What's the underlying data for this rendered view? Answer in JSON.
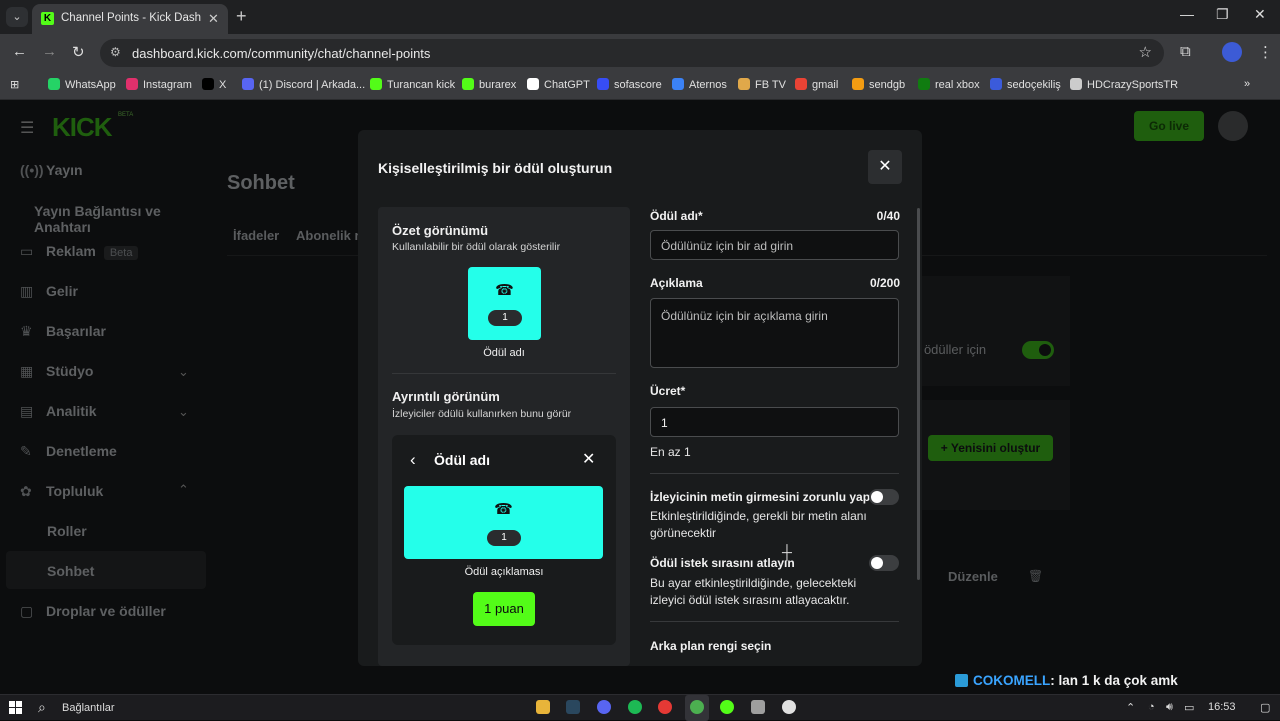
{
  "browser": {
    "tab_title": "Channel Points - Kick Dashboar",
    "url": "dashboard.kick.com/community/chat/channel-points",
    "bookmarks": [
      {
        "label": "WhatsApp",
        "color": "#25d366"
      },
      {
        "label": "Instagram",
        "color": "#e1306c"
      },
      {
        "label": "X",
        "color": "#000000"
      },
      {
        "label": "(1) Discord | Arkada...",
        "color": "#5865f2"
      },
      {
        "label": "Turancan kick",
        "color": "#53fc18"
      },
      {
        "label": "burarex",
        "color": "#53fc18"
      },
      {
        "label": "ChatGPT",
        "color": "#ffffff"
      },
      {
        "label": "sofascore",
        "color": "#374df5"
      },
      {
        "label": "Aternos",
        "color": "#3b82f6"
      },
      {
        "label": "FB TV",
        "color": "#e0a84a"
      },
      {
        "label": "gmail",
        "color": "#ea4335"
      },
      {
        "label": "sendgb",
        "color": "#f39c12"
      },
      {
        "label": "real xbox",
        "color": "#107c10"
      },
      {
        "label": "sedoçekiliş",
        "color": "#3b5bdb"
      },
      {
        "label": "HDCrazySportsTR",
        "color": "#cccccc"
      }
    ]
  },
  "sidebar": {
    "logo": "KICK",
    "logo_beta": "BETA",
    "items": [
      {
        "label": "Yayın",
        "icon": "broadcast-icon"
      },
      {
        "label": "Yayın Bağlantısı ve Anahtarı",
        "icon": ""
      },
      {
        "label": "Reklam",
        "icon": "ad-icon",
        "badge": "Beta"
      },
      {
        "label": "Gelir",
        "icon": "revenue-icon"
      },
      {
        "label": "Başarılar",
        "icon": "trophy-icon"
      },
      {
        "label": "Stüdyo",
        "icon": "studio-icon"
      },
      {
        "label": "Analitik",
        "icon": "analytics-icon"
      },
      {
        "label": "Denetleme",
        "icon": "moderation-icon"
      },
      {
        "label": "Topluluk",
        "icon": "community-icon"
      },
      {
        "label": "Roller",
        "icon": ""
      },
      {
        "label": "Sohbet",
        "icon": ""
      },
      {
        "label": "Droplar ve ödüller",
        "icon": "drops-icon"
      }
    ]
  },
  "main": {
    "title": "Sohbet",
    "tabs": [
      "İfadeler",
      "Abonelik r"
    ],
    "bg_text_rewards": "r ödüller için",
    "bg_create_button": "Yenisini oluştur",
    "bg_edit": "Düzenle",
    "go_live": "Go live"
  },
  "modal": {
    "title": "Kişiselleştirilmiş bir ödül oluşturun",
    "preview": {
      "summary_title": "Özet görünümü",
      "summary_sub": "Kullanılabilir bir ödül olarak gösterilir",
      "reward_cost": "1",
      "reward_name": "Ödül adı",
      "detail_title": "Ayrıntılı görünüm",
      "detail_sub": "İzleyiciler ödülü kullanırken bunu görür",
      "detail_header": "Ödül adı",
      "detail_cost": "1",
      "detail_desc": "Ödül açıklaması",
      "detail_button": "1 puan",
      "card_color": "#24ffea"
    },
    "form": {
      "name_label": "Ödül adı*",
      "name_count": "0/40",
      "name_placeholder": "Ödülünüz için bir ad girin",
      "desc_label": "Açıklama",
      "desc_count": "0/200",
      "desc_placeholder": "Ödülünüz için bir açıklama girin",
      "price_label": "Ücret*",
      "price_value": "1",
      "price_hint": "En az 1",
      "require_text_label": "İzleyicinin metin girmesini zorunlu yap",
      "require_text_desc": "Etkinleştirildiğinde, gerekli bir metin alanı görünecektir",
      "require_text_enabled": false,
      "skip_queue_label": "Ödül istek sırasını atlayın",
      "skip_queue_desc": "Bu ayar etkinleştirildiğinde, gelecekteki izleyici ödül istek sırasını atlayacaktır.",
      "skip_queue_enabled": false,
      "bg_color_label": "Arka plan rengi seçin"
    }
  },
  "chat_overlay": {
    "user": "COKOMELL",
    "message": ": lan 1 k da çok amk"
  },
  "taskbar": {
    "search_text": "Bağlantılar",
    "time": "16:53"
  }
}
